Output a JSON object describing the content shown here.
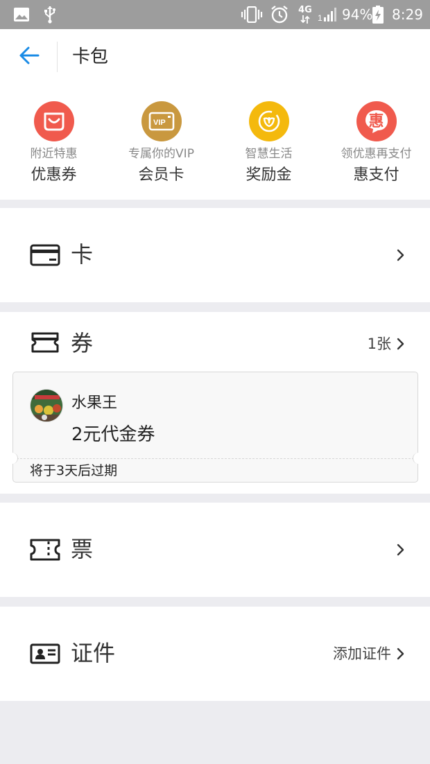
{
  "status_bar": {
    "network": "4G",
    "battery": "94%",
    "time": "8:29",
    "icons": [
      "image-icon",
      "usb-icon",
      "vibrate-icon",
      "alarm-icon",
      "network-4g-icon",
      "signal-icon",
      "battery-charging-icon"
    ]
  },
  "header": {
    "title": "卡包",
    "back_icon": "back-arrow-icon"
  },
  "quick_actions": [
    {
      "subtitle": "附近特惠",
      "name": "优惠券",
      "icon": "coupon-smile-icon",
      "color": "#f05a4d"
    },
    {
      "subtitle": "专属你的VIP",
      "name": "会员卡",
      "icon": "vip-card-icon",
      "color": "#c9983f",
      "icon_text": "VIP"
    },
    {
      "subtitle": "智慧生活",
      "name": "奖励金",
      "icon": "reward-coin-icon",
      "color": "#f4b90d"
    },
    {
      "subtitle": "领优惠再支付",
      "name": "惠支付",
      "icon": "hui-pay-icon",
      "color": "#f05a4d",
      "icon_text": "惠"
    }
  ],
  "sections": {
    "cards": {
      "label": "卡",
      "icon": "card-icon"
    },
    "coupons": {
      "label": "券",
      "count": "1张",
      "icon": "coupon-icon",
      "coupon": {
        "merchant": "水果王",
        "title": "2元代金券",
        "expiry": "将于3天后过期"
      }
    },
    "tickets": {
      "label": "票",
      "icon": "ticket-icon"
    },
    "ids": {
      "label": "证件",
      "action": "添加证件",
      "icon": "id-card-icon"
    }
  },
  "colors": {
    "accent": "#1a8be6",
    "status_bar": "#9d9d9d",
    "background": "#ececf0"
  }
}
